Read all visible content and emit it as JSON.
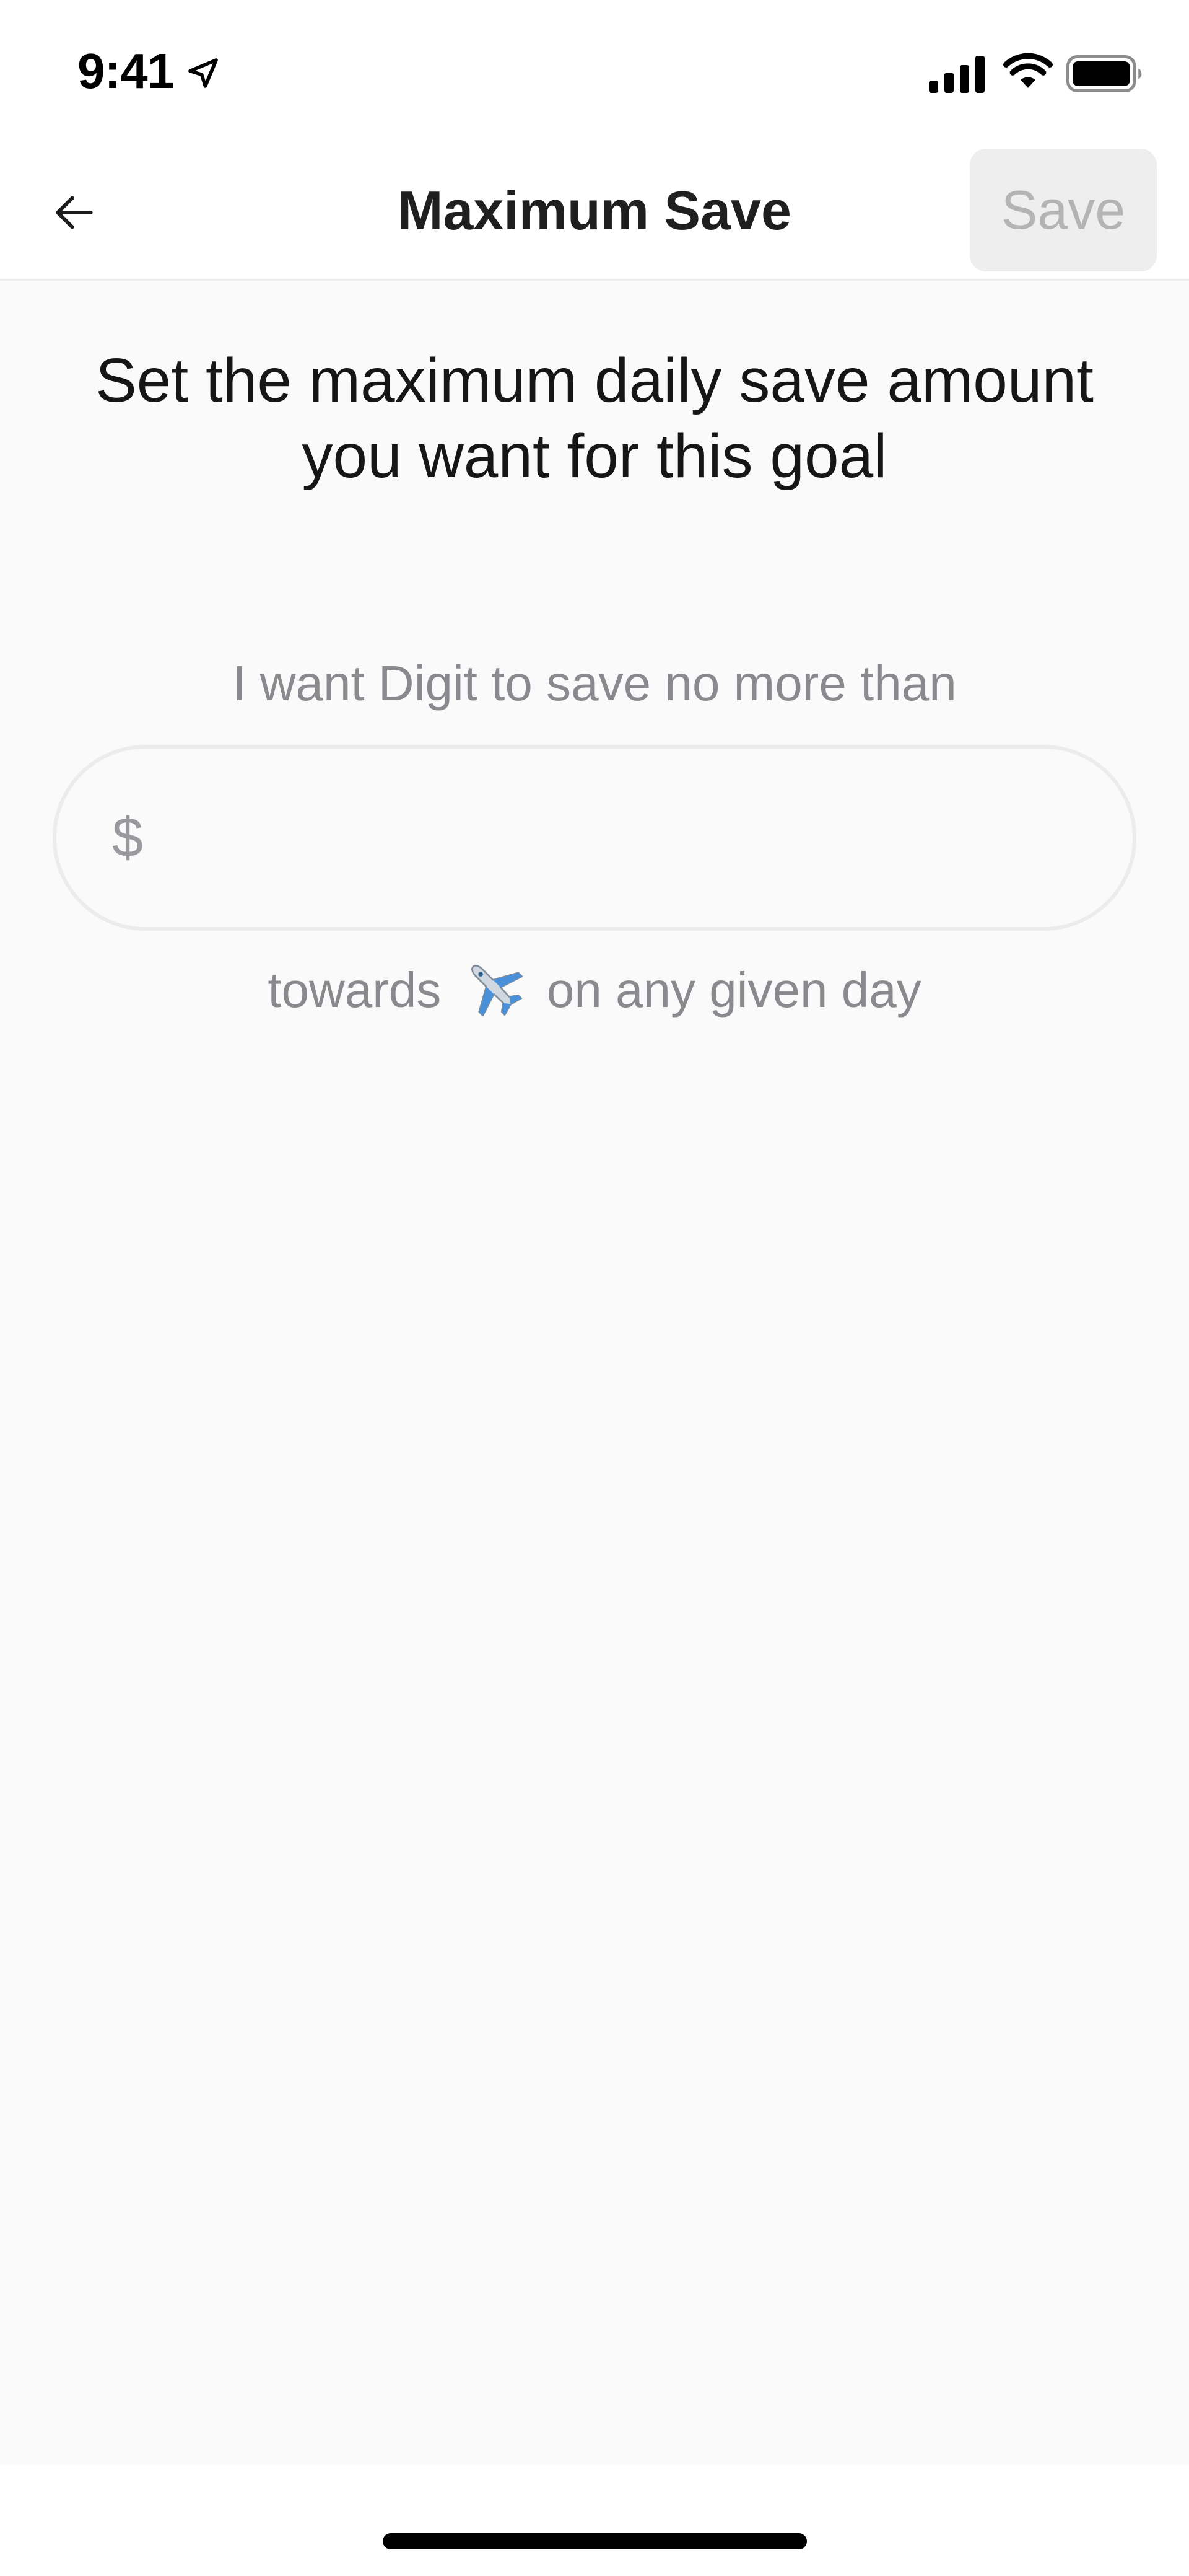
{
  "status_bar": {
    "time": "9:41",
    "icons": [
      "location-arrow-icon",
      "cellular-signal-icon",
      "wifi-icon",
      "battery-icon"
    ]
  },
  "nav": {
    "back_icon": "arrow-left-icon",
    "title": "Maximum Save",
    "save_label": "Save"
  },
  "main": {
    "heading": "Set the maximum daily save amount you want for this goal",
    "prompt": "I want Digit to save no more than",
    "amount": {
      "currency_symbol": "$",
      "value": "",
      "placeholder": ""
    },
    "suffix_before": "towards",
    "goal_icon": "airplane-icon",
    "suffix_after": "on any given day"
  },
  "colors": {
    "accent_disabled_bg": "#eeeeee",
    "accent_disabled_text": "#b4b4b4",
    "content_bg": "#fafafa",
    "secondary_text": "#8a8a8e"
  }
}
